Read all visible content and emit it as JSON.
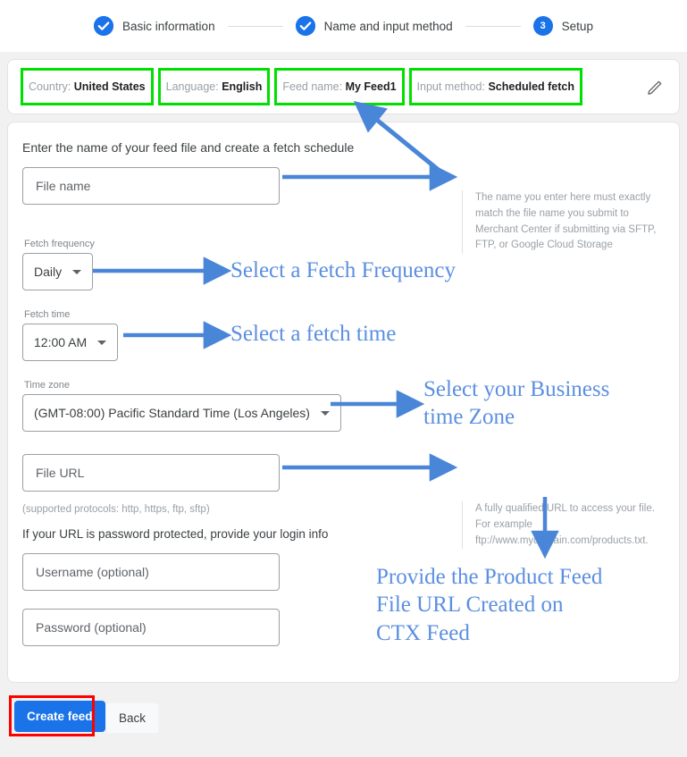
{
  "stepper": {
    "steps": [
      {
        "label": "Basic information",
        "state": "complete",
        "number": "1"
      },
      {
        "label": "Name and input method",
        "state": "complete",
        "number": "2"
      },
      {
        "label": "Setup",
        "state": "active",
        "number": "3"
      }
    ]
  },
  "summary_chips": [
    {
      "key": "Country:",
      "value": "United States"
    },
    {
      "key": "Language:",
      "value": "English"
    },
    {
      "key": "Feed name:",
      "value": "My Feed1"
    },
    {
      "key": "Input method:",
      "value": "Scheduled fetch"
    }
  ],
  "edit_icon": "pencil-icon",
  "form": {
    "section_title": "Enter the name of your feed file and create a fetch schedule",
    "file_name": {
      "placeholder": "File name",
      "value": ""
    },
    "fetch_frequency": {
      "label": "Fetch frequency",
      "value": "Daily"
    },
    "fetch_time": {
      "label": "Fetch time",
      "value": "12:00 AM"
    },
    "time_zone": {
      "label": "Time zone",
      "value": "(GMT-08:00) Pacific Standard Time (Los Angeles)"
    },
    "file_url": {
      "placeholder": "File URL",
      "value": ""
    },
    "protocols_note": "(supported protocols: http, https, ftp, sftp)",
    "login_note": "If your URL is password protected, provide your login info",
    "username": {
      "placeholder": "Username (optional)",
      "value": ""
    },
    "password": {
      "placeholder": "Password (optional)",
      "value": ""
    }
  },
  "help": {
    "file_name": "The name you enter here must exactly match the file name you submit to Merchant Center if submitting via SFTP, FTP, or Google Cloud Storage",
    "file_url": "A fully qualified URL to access your file. For example ftp://www.mydomain.com/products.txt."
  },
  "footer": {
    "create_label": "Create feed",
    "back_label": "Back"
  },
  "annotations": [
    {
      "text": "Select a Fetch Frequency"
    },
    {
      "text": "Select a fetch time"
    },
    {
      "text": "Select your Business\ntime Zone"
    },
    {
      "text": "Provide the Product Feed\nFile URL Created on\nCTX Feed"
    }
  ],
  "colors": {
    "accent_blue": "#1a73e8",
    "annotation_blue": "#5b8fe0",
    "highlight_green": "#00e000",
    "highlight_red": "#ff0000",
    "page_background": "#f1f1f1"
  }
}
